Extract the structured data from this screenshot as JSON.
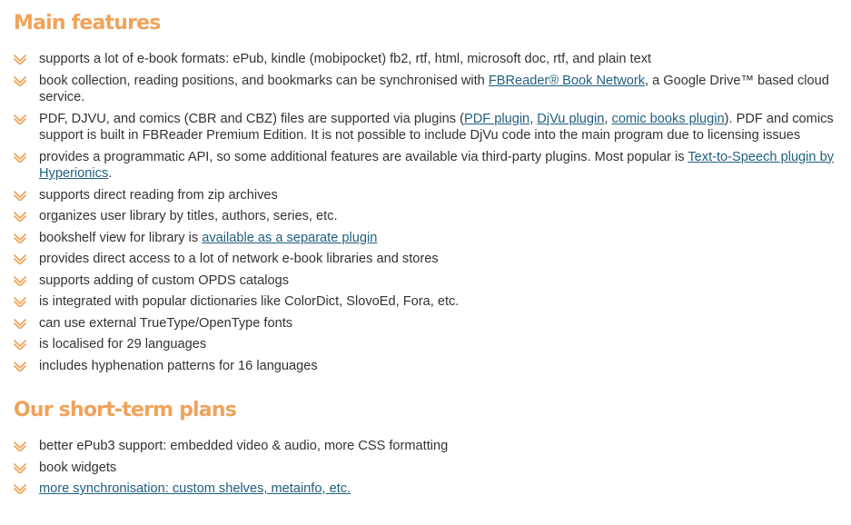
{
  "section_main": {
    "title": "Main features",
    "items": [
      {
        "parts": [
          {
            "t": "supports a lot of e-book formats: ePub, kindle (mobipocket) fb2, rtf, html, microsoft doc, rtf, and plain text"
          }
        ]
      },
      {
        "parts": [
          {
            "t": "book collection, reading positions, and bookmarks can be synchronised with "
          },
          {
            "t": "FBReader® Book Network",
            "link": true
          },
          {
            "t": ", a Google Drive™ based cloud service."
          }
        ]
      },
      {
        "parts": [
          {
            "t": "PDF, DJVU, and comics (CBR and CBZ) files are supported via plugins ("
          },
          {
            "t": "PDF plugin",
            "link": true
          },
          {
            "t": ", "
          },
          {
            "t": "DjVu plugin",
            "link": true
          },
          {
            "t": ", "
          },
          {
            "t": "comic books plugin",
            "link": true
          },
          {
            "t": "). PDF and comics support is built in FBReader Premium Edition. It is not possible to include DjVu code into the main program due to licensing issues"
          }
        ]
      },
      {
        "parts": [
          {
            "t": "provides a programmatic API, so some additional features are available via third-party plugins. Most popular is "
          },
          {
            "t": "Text-to-Speech plugin by Hyperionics",
            "link": true
          },
          {
            "t": "."
          }
        ]
      },
      {
        "parts": [
          {
            "t": "supports direct reading from zip archives"
          }
        ]
      },
      {
        "parts": [
          {
            "t": "organizes user library by titles, authors, series, etc."
          }
        ]
      },
      {
        "parts": [
          {
            "t": "bookshelf view for library is "
          },
          {
            "t": "available as a separate plugin",
            "link": true
          }
        ]
      },
      {
        "parts": [
          {
            "t": "provides direct access to a lot of network e-book libraries and stores"
          }
        ]
      },
      {
        "parts": [
          {
            "t": "supports adding of custom OPDS catalogs"
          }
        ]
      },
      {
        "parts": [
          {
            "t": "is integrated with popular dictionaries like ColorDict, SlovoEd, Fora, etc."
          }
        ]
      },
      {
        "parts": [
          {
            "t": "can use external TrueType/OpenType fonts"
          }
        ]
      },
      {
        "parts": [
          {
            "t": "is localised for 29 languages"
          }
        ]
      },
      {
        "parts": [
          {
            "t": "includes hyphenation patterns for 16 languages"
          }
        ]
      }
    ]
  },
  "section_plans": {
    "title": "Our short-term plans",
    "items": [
      {
        "parts": [
          {
            "t": "better ePub3 support: embedded video & audio, more CSS formatting"
          }
        ]
      },
      {
        "parts": [
          {
            "t": "book widgets"
          }
        ]
      },
      {
        "parts": [
          {
            "t": "more synchronisation: custom shelves, metainfo, etc.",
            "link": true
          }
        ]
      }
    ]
  },
  "colors": {
    "heading": "#f0a35b",
    "check": "#f0a35b",
    "link": "#1f5f7f",
    "text": "#333333"
  },
  "icons": {
    "bullet": "checkmark-icon"
  }
}
